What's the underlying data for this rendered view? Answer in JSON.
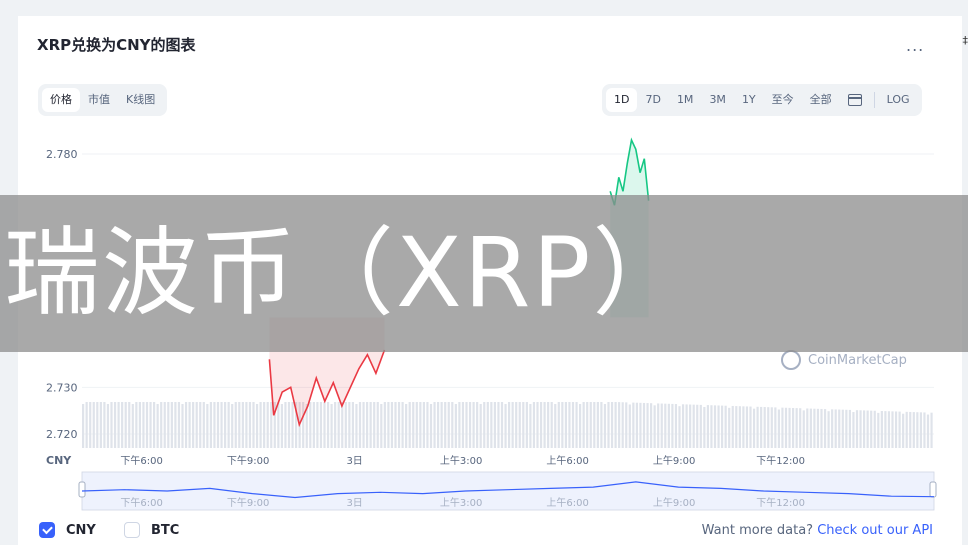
{
  "header": {
    "title": "XRP兑换为CNY的图表",
    "more_label": "...",
    "edge_glyph": "‡"
  },
  "view_tabs": [
    {
      "label": "价格",
      "active": true
    },
    {
      "label": "市值",
      "active": false
    },
    {
      "label": "K线图",
      "active": false
    }
  ],
  "range_tabs": [
    {
      "label": "1D",
      "active": true
    },
    {
      "label": "7D",
      "active": false
    },
    {
      "label": "1M",
      "active": false
    },
    {
      "label": "3M",
      "active": false
    },
    {
      "label": "1Y",
      "active": false
    },
    {
      "label": "至今",
      "active": false
    },
    {
      "label": "全部",
      "active": false
    }
  ],
  "calendar_icon": "calendar-icon",
  "log_label": "LOG",
  "banner_text": "瑞波币（XRP）",
  "watermark": "CoinMarketCap",
  "legend": [
    {
      "label": "CNY",
      "checked": true
    },
    {
      "label": "BTC",
      "checked": false
    }
  ],
  "footer": {
    "prefix": "Want more data? ",
    "link": "Check out our API"
  },
  "colors": {
    "accent": "#3861fb",
    "up": "#16c784",
    "down": "#ea3943",
    "grid": "#eff2f5"
  },
  "chart_data": {
    "type": "line",
    "y_ticks": [
      "2.780",
      "2.730",
      "2.720"
    ],
    "y_axis_label": "CNY",
    "x_ticks": [
      "下午6:00",
      "下午9:00",
      "3日",
      "上午3:00",
      "上午6:00",
      "上午9:00",
      "下午12:00"
    ],
    "navigator_ticks": [
      "下午6:00",
      "下午9:00",
      "3日",
      "上午3:00",
      "上午6:00",
      "上午9:00",
      "下午12:00"
    ],
    "ylim": [
      2.717,
      2.783
    ],
    "red_segment": {
      "x": [
        0.22,
        0.225,
        0.235,
        0.245,
        0.255,
        0.265,
        0.275,
        0.285,
        0.295,
        0.305,
        0.315,
        0.325,
        0.335,
        0.345,
        0.355
      ],
      "y": [
        2.736,
        2.724,
        2.729,
        2.73,
        2.722,
        2.726,
        2.732,
        2.727,
        2.731,
        2.726,
        2.73,
        2.734,
        2.737,
        2.733,
        2.738
      ]
    },
    "green_segment": {
      "x": [
        0.62,
        0.625,
        0.63,
        0.635,
        0.64,
        0.645,
        0.65,
        0.655,
        0.66,
        0.665
      ],
      "y": [
        2.772,
        2.769,
        2.775,
        2.772,
        2.778,
        2.783,
        2.781,
        2.776,
        2.779,
        2.77
      ]
    },
    "navigator": {
      "x": [
        0,
        0.05,
        0.1,
        0.15,
        0.2,
        0.25,
        0.3,
        0.35,
        0.4,
        0.45,
        0.5,
        0.55,
        0.6,
        0.65,
        0.7,
        0.75,
        0.8,
        0.85,
        0.9,
        0.95,
        1
      ],
      "y": [
        0.5,
        0.45,
        0.5,
        0.4,
        0.6,
        0.75,
        0.6,
        0.55,
        0.6,
        0.5,
        0.45,
        0.4,
        0.35,
        0.15,
        0.35,
        0.4,
        0.5,
        0.55,
        0.6,
        0.7,
        0.72
      ]
    },
    "grid": true
  }
}
